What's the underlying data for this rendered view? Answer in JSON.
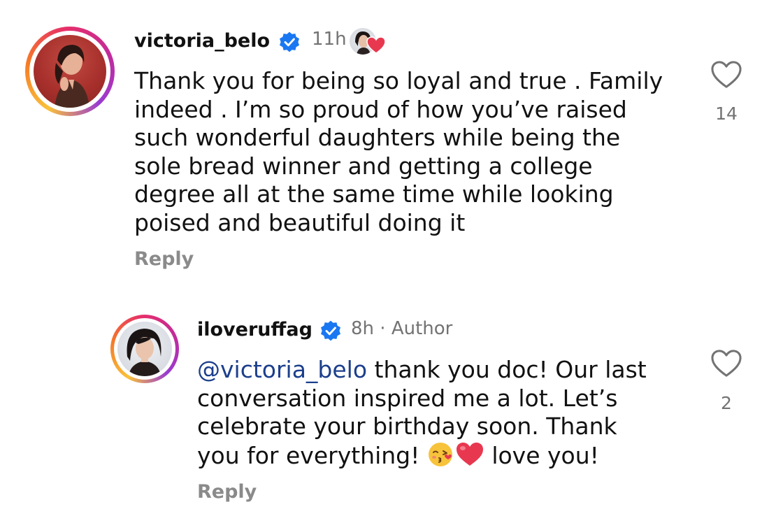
{
  "comments": [
    {
      "username": "victoria_belo",
      "time": "11h",
      "text": "Thank you for being so loyal and  true . Family\nindeed . I’m so proud of how you’ve raised\nsuch wonderful daughters while being the\nsole bread winner and getting a college\ndegree all at the same time while looking\npoised and beautiful doing it",
      "reply_label": "Reply",
      "likes": "14",
      "verified_icon": "verified-badge-icon",
      "liked_by_author_icon": "author-liked-heart-icon"
    },
    {
      "username": "iloveruffag",
      "time": "8h",
      "separator": "·",
      "author_label": "Author",
      "mention": "@victoria_belo",
      "text_after_mention": " thank you doc! Our last\nconversation inspired me a lot. Let’s\ncelebrate your birthday soon. Thank\nyou for everything! ",
      "text_end": " love you!",
      "emojis": [
        "kissing-face-emoji",
        "red-heart-emoji"
      ],
      "reply_label": "Reply",
      "likes": "2",
      "verified_icon": "verified-badge-icon"
    }
  ],
  "colors": {
    "mention": "#1c3f8c",
    "verified": "#1a77f2",
    "secondary_text": "#737373",
    "heart": "#e8384f"
  }
}
